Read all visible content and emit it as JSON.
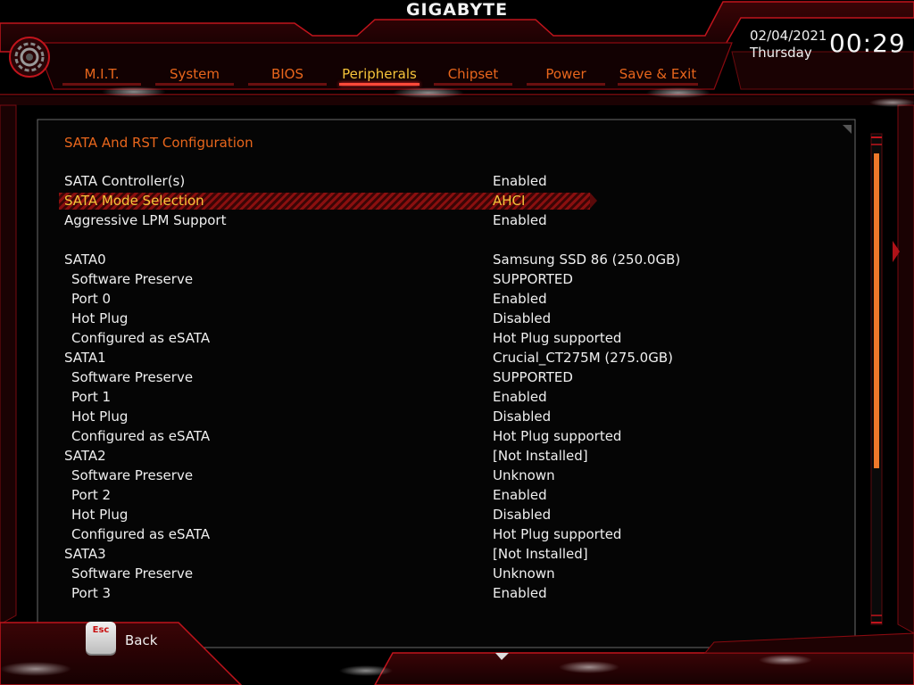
{
  "brand": "GIGABYTE",
  "clock": {
    "date": "02/04/2021",
    "day": "Thursday",
    "time": "00:29"
  },
  "tabs": [
    {
      "label": "M.I.T.",
      "active": false
    },
    {
      "label": "System",
      "active": false
    },
    {
      "label": "BIOS",
      "active": false
    },
    {
      "label": "Peripherals",
      "active": true
    },
    {
      "label": "Chipset",
      "active": false
    },
    {
      "label": "Power",
      "active": false
    },
    {
      "label": "Save & Exit",
      "active": false
    }
  ],
  "panel": {
    "title": "SATA And RST Configuration",
    "rows": [
      {
        "label": "SATA Controller(s)",
        "value": "Enabled"
      },
      {
        "label": "SATA Mode Selection",
        "value": "AHCI",
        "selected": true
      },
      {
        "label": "Aggressive LPM Support",
        "value": "Enabled"
      },
      {
        "label": "SATA0",
        "value": "Samsung SSD 86 (250.0GB)"
      },
      {
        "label": "Software Preserve",
        "value": "SUPPORTED",
        "sub": true
      },
      {
        "label": "Port 0",
        "value": "Enabled",
        "sub": true
      },
      {
        "label": "Hot Plug",
        "value": "Disabled",
        "sub": true
      },
      {
        "label": "Configured as eSATA",
        "value": "Hot Plug supported",
        "sub": true
      },
      {
        "label": "SATA1",
        "value": "Crucial_CT275M (275.0GB)"
      },
      {
        "label": "Software Preserve",
        "value": "SUPPORTED",
        "sub": true
      },
      {
        "label": "Port 1",
        "value": "Enabled",
        "sub": true
      },
      {
        "label": "Hot Plug",
        "value": "Disabled",
        "sub": true
      },
      {
        "label": "Configured as eSATA",
        "value": "Hot Plug supported",
        "sub": true
      },
      {
        "label": "SATA2",
        "value": "[Not Installed]"
      },
      {
        "label": "Software Preserve",
        "value": "Unknown",
        "sub": true
      },
      {
        "label": "Port 2",
        "value": "Enabled",
        "sub": true
      },
      {
        "label": "Hot Plug",
        "value": "Disabled",
        "sub": true
      },
      {
        "label": "Configured as eSATA",
        "value": "Hot Plug supported",
        "sub": true
      },
      {
        "label": "SATA3",
        "value": "[Not Installed]"
      },
      {
        "label": "Software Preserve",
        "value": "Unknown",
        "sub": true
      },
      {
        "label": "Port 3",
        "value": "Enabled",
        "sub": true
      }
    ]
  },
  "footer": {
    "esc_key": "Esc",
    "back_label": "Back"
  },
  "scrollbar": {
    "visible_fraction": 0.84
  },
  "colors": {
    "accent_orange": "#e8661c",
    "selected_yellow": "#f5c43a",
    "frame_red": "#c0141c",
    "background": "#000000"
  },
  "icons": {
    "logo_emblem": "gear-icon"
  }
}
